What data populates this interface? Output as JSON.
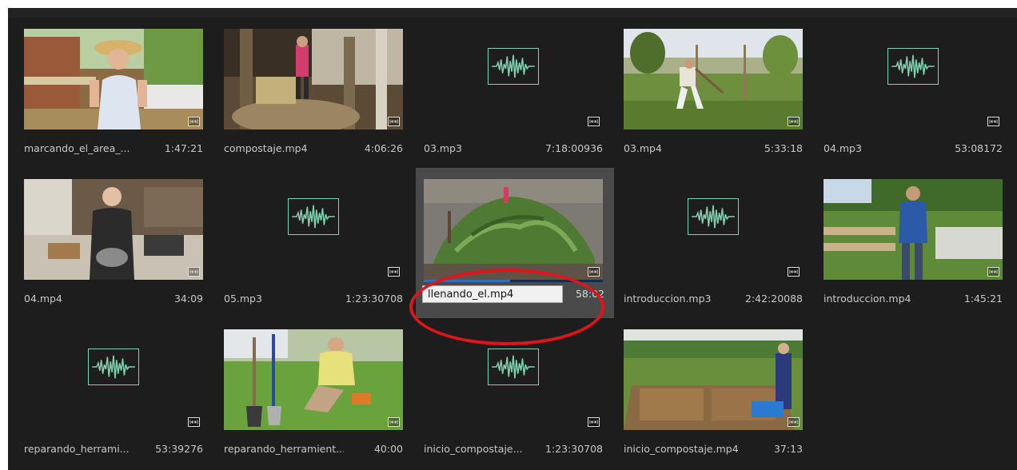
{
  "panel": {
    "background": "#1d1d1d",
    "accent_wave": "#7fd1b0",
    "annotation_color": "#e0141b"
  },
  "items": [
    {
      "name": "marcando_el_area_...",
      "duration": "1:47:21",
      "kind": "video",
      "thumb_icon": "woman-in-hat-photo"
    },
    {
      "name": "compostaje.mp4",
      "duration": "4:06:26",
      "kind": "video",
      "thumb_icon": "barn-compost-photo"
    },
    {
      "name": "03.mp3",
      "duration": "7:18:00936",
      "kind": "audio",
      "thumb_icon": "audio-waveform-icon"
    },
    {
      "name": "03.mp4",
      "duration": "5:33:18",
      "kind": "video",
      "thumb_icon": "field-digging-photo"
    },
    {
      "name": "04.mp3",
      "duration": "53:08172",
      "kind": "audio",
      "thumb_icon": "audio-waveform-icon"
    },
    {
      "name": "04.mp4",
      "duration": "34:09",
      "kind": "video",
      "thumb_icon": "kitchen-woman-photo"
    },
    {
      "name": "05.mp3",
      "duration": "1:23:30708",
      "kind": "audio",
      "thumb_icon": "audio-waveform-icon"
    },
    {
      "name": "llenando_el.mp4",
      "duration": "58:02",
      "kind": "video",
      "selected": true,
      "renaming": true,
      "thumb_icon": "compost-pile-photo"
    },
    {
      "name": "introduccion.mp3",
      "duration": "2:42:20088",
      "kind": "audio",
      "thumb_icon": "audio-waveform-icon"
    },
    {
      "name": "introduccion.mp4",
      "duration": "1:45:21",
      "kind": "video",
      "thumb_icon": "man-in-garden-photo"
    },
    {
      "name": "reparando_herrami...",
      "duration": "53:39276",
      "kind": "audio",
      "thumb_icon": "audio-waveform-icon"
    },
    {
      "name": "reparando_herramient...",
      "duration": "40:00",
      "kind": "video",
      "thumb_icon": "tool-repair-photo"
    },
    {
      "name": "inicio_compostaje...",
      "duration": "1:23:30708",
      "kind": "audio",
      "thumb_icon": "audio-waveform-icon"
    },
    {
      "name": "inicio_compostaje.mp4",
      "duration": "37:13",
      "kind": "video",
      "thumb_icon": "compost-bins-photo"
    }
  ],
  "rename_field": {
    "value": "llenando_el.mp4"
  }
}
